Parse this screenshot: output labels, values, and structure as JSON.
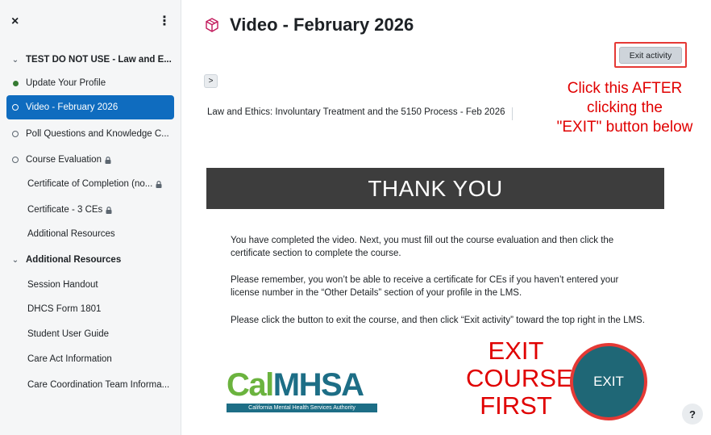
{
  "sidebar": {
    "close_glyph": "×",
    "menu_glyph": "⋮",
    "items": [
      {
        "label": "TEST DO NOT USE - Law and E...",
        "kind": "section",
        "state": "expanded"
      },
      {
        "label": "Update Your Profile",
        "kind": "activity",
        "state": "completed"
      },
      {
        "label": "Video - February 2026",
        "kind": "activity",
        "state": "current"
      },
      {
        "label": "Poll Questions and Knowledge C...",
        "kind": "activity",
        "state": "incomplete"
      },
      {
        "label": "Course Evaluation",
        "kind": "activity",
        "state": "incomplete",
        "locked": true
      },
      {
        "label": "Certificate of Completion (no...",
        "kind": "activity",
        "state": "none",
        "locked": true
      },
      {
        "label": "Certificate - 3 CEs",
        "kind": "activity",
        "state": "none",
        "locked": true
      },
      {
        "label": "Additional Resources",
        "kind": "activity",
        "state": "none"
      },
      {
        "label": "Additional Resources",
        "kind": "section",
        "state": "expanded"
      },
      {
        "label": "Session Handout",
        "kind": "activity",
        "state": "none"
      },
      {
        "label": "DHCS Form 1801",
        "kind": "activity",
        "state": "none"
      },
      {
        "label": "Student User Guide",
        "kind": "activity",
        "state": "none"
      },
      {
        "label": "Care Act Information",
        "kind": "activity",
        "state": "none"
      },
      {
        "label": "Care Coordination Team Informa...",
        "kind": "activity",
        "state": "none"
      }
    ]
  },
  "page": {
    "title": "Video - February 2026",
    "exit_activity_label": "Exit activity",
    "expand_glyph": ">",
    "description": "Law and Ethics: Involuntary Treatment and the 5150 Process - Feb 2026",
    "annotation_top": [
      "Click this AFTER",
      "clicking the",
      "\"EXIT\" button below"
    ],
    "help_glyph": "?"
  },
  "embed": {
    "banner": "THANK YOU",
    "paragraphs": [
      "You have completed the video. Next, you must fill out the course evaluation and then click the certificate section to complete the course.",
      "Please remember, you won’t be able to receive a certificate for CEs if you haven’t entered your license number in the “Other Details” section of your profile in the LMS.",
      "Please click the button to exit the course, and then click “Exit activity” toward the top right in the LMS."
    ],
    "logo_cal": "Cal",
    "logo_mhsa": "MHSA",
    "logo_tagline": "California Mental Health Services Authority",
    "annotation_exit": [
      "EXIT",
      "COURSE",
      "FIRST"
    ],
    "exit_label": "EXIT"
  },
  "colors": {
    "active": "#0f6cbf",
    "completed_dot": "#357a32",
    "annotation_red": "#e00000",
    "exit_circle": "#1f6776",
    "banner": "#3d3d3d",
    "logo_green": "#6bb33e",
    "logo_teal": "#1d6e86"
  },
  "icons": {
    "title": "cube-icon",
    "lock": "lock-icon"
  }
}
